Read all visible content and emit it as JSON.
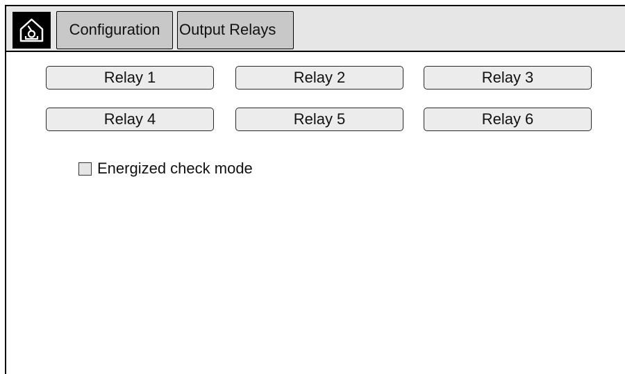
{
  "topbar": {
    "home_icon": "home-icon",
    "breadcrumbs": [
      "Configuration",
      "Output Relays"
    ]
  },
  "relays": {
    "buttons": [
      "Relay 1",
      "Relay 2",
      "Relay 3",
      "Relay 4",
      "Relay 5",
      "Relay 6"
    ]
  },
  "options": {
    "energized_check_mode": {
      "label": "Energized check mode",
      "checked": false
    }
  },
  "colors": {
    "topbar_bg": "#e6e6e6",
    "breadcrumb_bg": "#c8c8c8",
    "button_bg": "#ececec",
    "home_bg": "#000000"
  }
}
